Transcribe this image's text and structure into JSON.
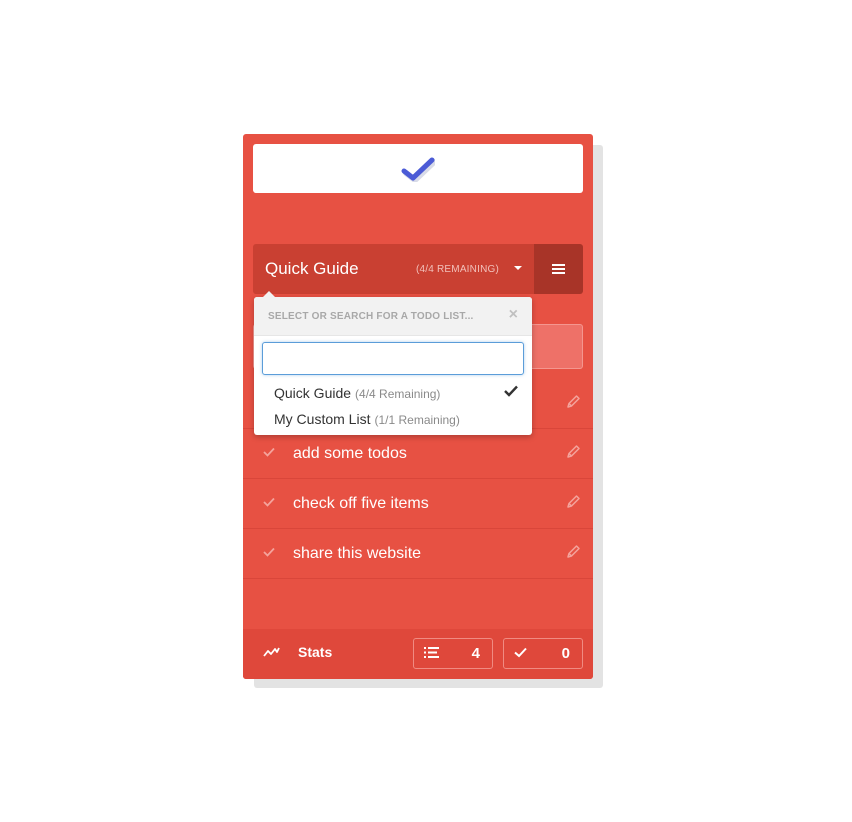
{
  "list_bar": {
    "title": "Quick Guide",
    "remaining": "(4/4 REMAINING)"
  },
  "dropdown": {
    "hint": "SELECT OR SEARCH FOR A TODO LIST...",
    "close_symbol": "×",
    "search_value": "",
    "items": [
      {
        "name": "Quick Guide",
        "remaining": "(4/4 Remaining)",
        "selected": true
      },
      {
        "name": "My Custom List",
        "remaining": "(1/1 Remaining)",
        "selected": false
      }
    ]
  },
  "todos": [
    {
      "label": "",
      "icon": "pencil-icon"
    },
    {
      "label": "add some todos",
      "icon": "pencil-icon"
    },
    {
      "label": "check off five items",
      "icon": "pencil-icon"
    },
    {
      "label": "share this website",
      "icon": "pencil-icon"
    }
  ],
  "footer": {
    "stats_label": "Stats",
    "todo_count": "4",
    "done_count": "0"
  },
  "colors": {
    "brand": "#e75143",
    "accent": "#4b5bd6"
  }
}
